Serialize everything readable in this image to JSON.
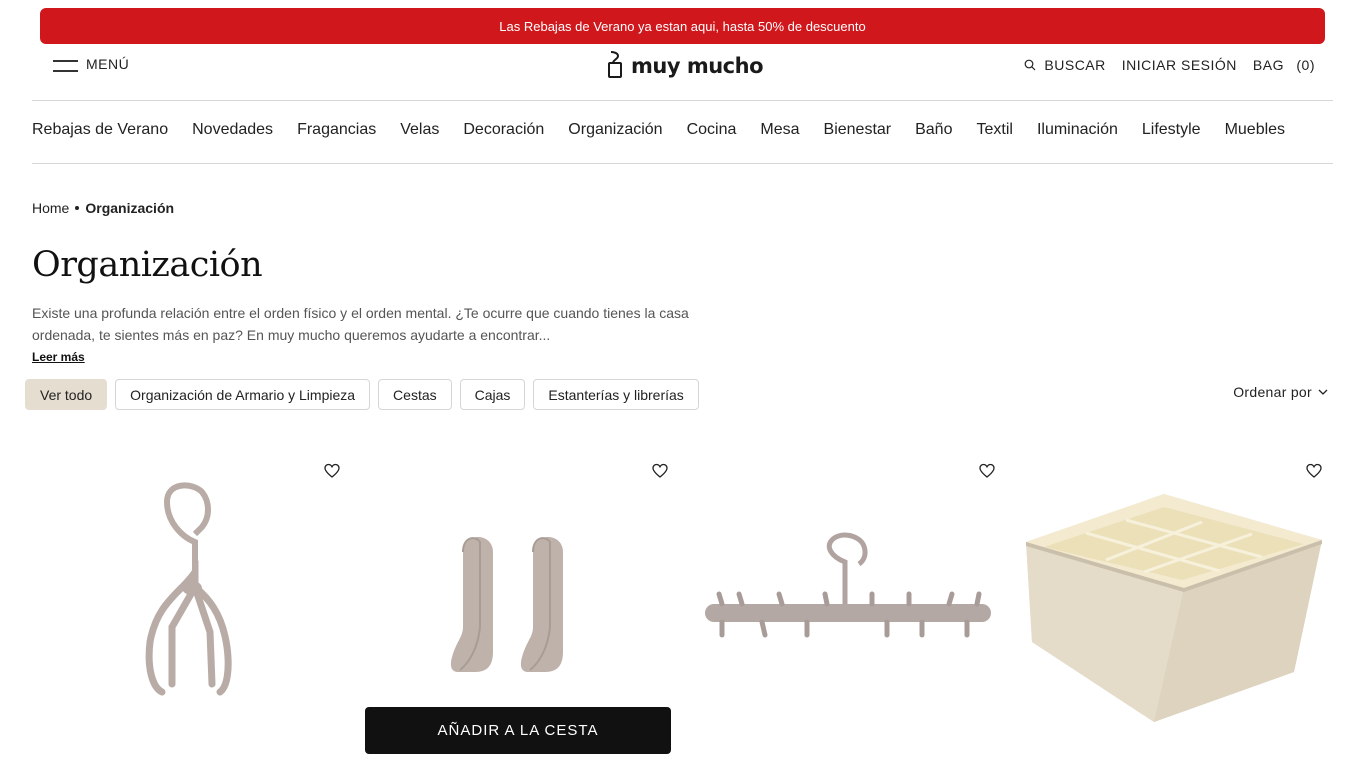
{
  "promo": {
    "text": "Las Rebajas de Verano ya estan aqui, hasta 50% de descuento",
    "color": "#d0171c"
  },
  "header": {
    "menu_label": "MENÚ",
    "logo_text": "muy mucho",
    "search_label": "BUSCAR",
    "login_label": "INICIAR SESIÓN",
    "bag_label": "BAG",
    "bag_count": "(0)"
  },
  "categories": [
    "Rebajas de Verano",
    "Novedades",
    "Fragancias",
    "Velas",
    "Decoración",
    "Organización",
    "Cocina",
    "Mesa",
    "Bienestar",
    "Baño",
    "Textil",
    "Iluminación",
    "Lifestyle",
    "Muebles"
  ],
  "breadcrumb": {
    "home": "Home",
    "current": "Organización"
  },
  "page": {
    "title": "Organización",
    "description": "Existe una profunda relación entre el orden físico y el orden mental. ¿Te ocurre que cuando tienes la casa ordenada, te sientes más en paz? En muy mucho queremos ayudarte a encontrar...",
    "read_more": "Leer más"
  },
  "filters": [
    "Ver todo",
    "Organización de Armario y Limpieza",
    "Cestas",
    "Cajas",
    "Estanterías y librerías"
  ],
  "sort_label": "Ordenar por",
  "products": [
    {
      "image": "rotating-hook-hanger"
    },
    {
      "image": "adhesive-hooks-pair"
    },
    {
      "image": "multi-hook-hanger-bar"
    },
    {
      "image": "drawer-organizer-box"
    }
  ],
  "add_to_cart_label": "AÑADIR A LA CESTA",
  "colors": {
    "accent": "#d0171c",
    "chip_active": "#e6ddd1",
    "product": "#b9aca6"
  }
}
